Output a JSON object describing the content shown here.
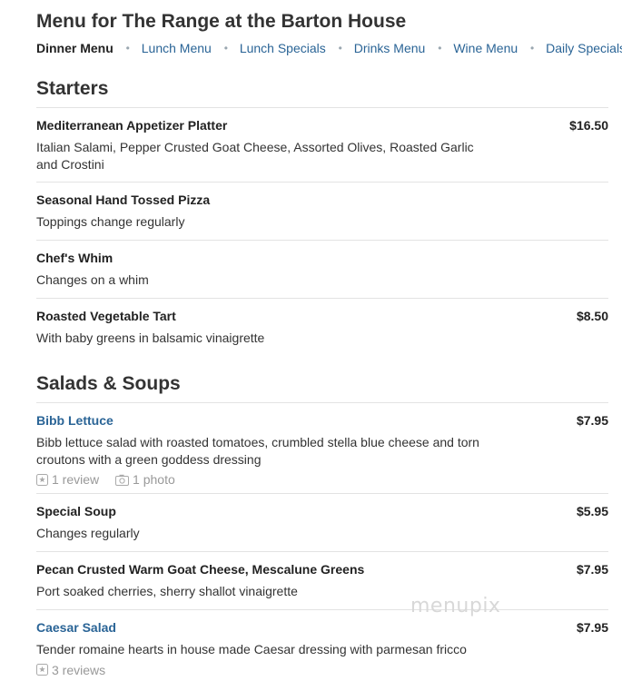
{
  "page_title": "Menu for The Range at the Barton House",
  "tabs": [
    {
      "label": "Dinner Menu",
      "active": true
    },
    {
      "label": "Lunch Menu",
      "active": false
    },
    {
      "label": "Lunch Specials",
      "active": false
    },
    {
      "label": "Drinks Menu",
      "active": false
    },
    {
      "label": "Wine Menu",
      "active": false
    },
    {
      "label": "Daily Specials",
      "active": false
    }
  ],
  "separator": "•",
  "sections": [
    {
      "title": "Starters",
      "items": [
        {
          "name": "Mediterranean Appetizer Platter",
          "price": "$16.50",
          "desc": "Italian Salami, Pepper Crusted Goat Cheese, Assorted Olives, Roasted Garlic and Crostini"
        },
        {
          "name": "Seasonal Hand Tossed Pizza",
          "price": "",
          "desc": "Toppings change regularly"
        },
        {
          "name": "Chef's Whim",
          "price": "",
          "desc": "Changes on a whim"
        },
        {
          "name": "Roasted Vegetable Tart",
          "price": "$8.50",
          "desc": "With baby greens in balsamic vinaigrette"
        }
      ]
    },
    {
      "title": "Salads & Soups",
      "items": [
        {
          "name": "Bibb Lettuce",
          "price": "$7.95",
          "link": true,
          "desc": "Bibb lettuce salad with roasted tomatoes, crumbled stella blue cheese and torn croutons with a green goddess dressing",
          "reviews": "1 review",
          "photos": "1 photo"
        },
        {
          "name": "Special Soup",
          "price": "$5.95",
          "desc": "Changes regularly"
        },
        {
          "name": "Pecan Crusted Warm Goat Cheese, Mescalune Greens",
          "price": "$7.95",
          "desc": "Port soaked cherries, sherry shallot vinaigrette"
        },
        {
          "name": "Caesar Salad",
          "price": "$7.95",
          "link": true,
          "desc": "Tender romaine hearts in house made Caesar dressing with parmesan fricco",
          "reviews": "3 reviews"
        }
      ]
    }
  ],
  "watermark": "menupix",
  "colors": {
    "link": "#2a6496",
    "text": "#333333",
    "muted": "#999999",
    "divider": "#e3e3e3"
  },
  "icons": {
    "review": "star-box-icon",
    "photo": "camera-icon"
  }
}
